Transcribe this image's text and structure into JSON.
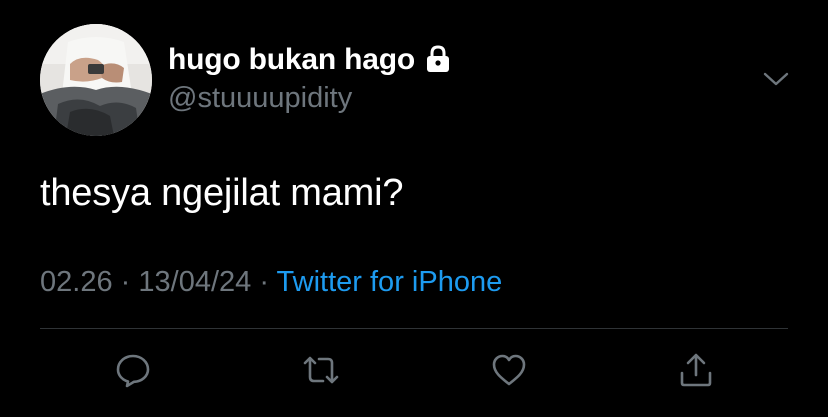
{
  "tweet": {
    "display_name": "hugo bukan hago",
    "handle": "@stuuuupidity",
    "text": "thesya ngejilat mami?",
    "time": "02.26",
    "separator": "·",
    "date": "13/04/24",
    "source": "Twitter for iPhone",
    "protected": true
  },
  "icons": {
    "lock": "lock-icon",
    "caret": "chevron-down-icon",
    "reply": "reply-icon",
    "retweet": "retweet-icon",
    "like": "heart-icon",
    "share": "share-icon"
  },
  "colors": {
    "background": "#000000",
    "primary_text": "#ffffff",
    "secondary_text": "#6e767d",
    "link": "#1d9bf0",
    "divider": "#2f3336"
  }
}
